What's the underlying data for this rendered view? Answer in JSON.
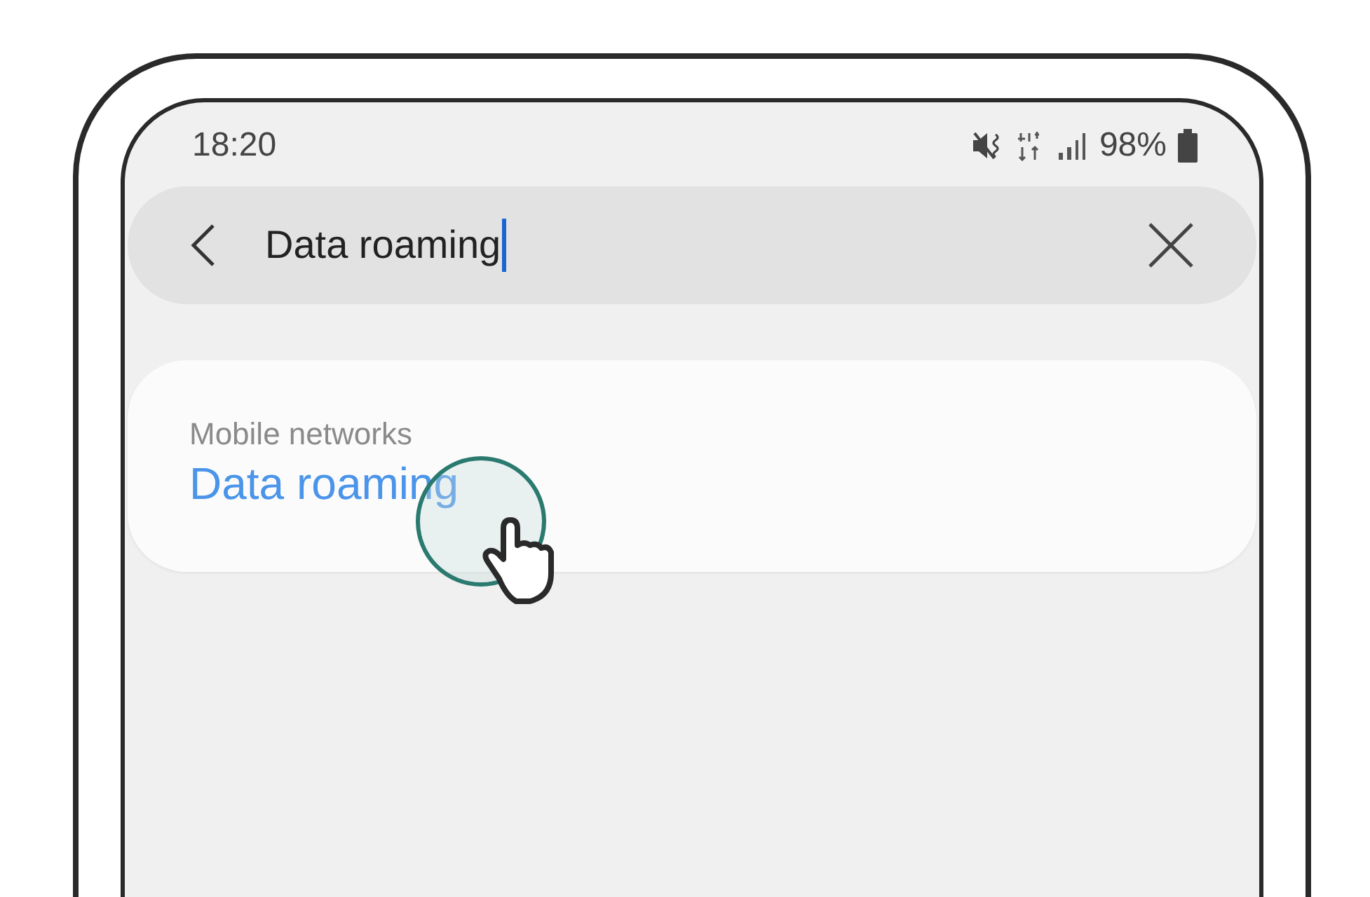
{
  "status_bar": {
    "time": "18:20",
    "battery": "98%"
  },
  "search": {
    "value": "Data roaming"
  },
  "results": [
    {
      "category": "Mobile networks",
      "title": "Data roaming"
    }
  ]
}
